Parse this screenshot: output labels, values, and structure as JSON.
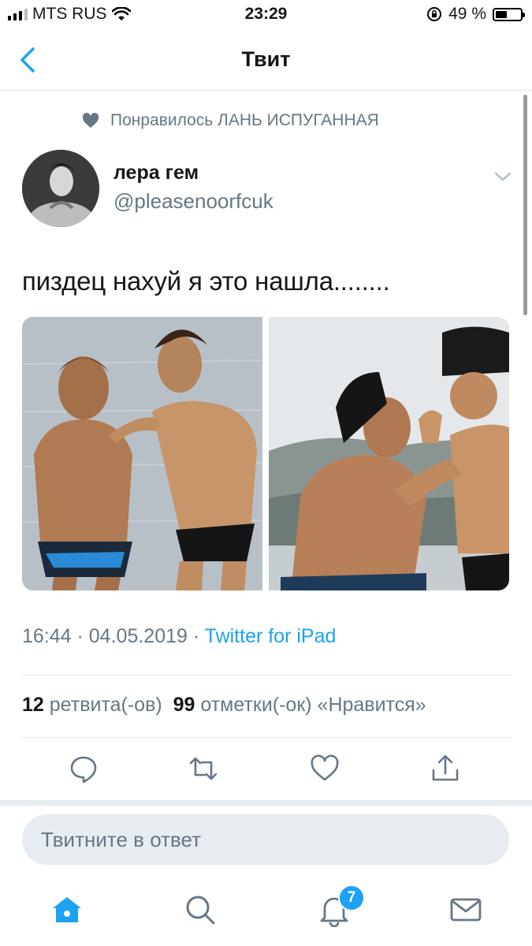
{
  "status": {
    "carrier": "MTS RUS",
    "time": "23:29",
    "battery_percent": "49 %",
    "battery_level": 0.49
  },
  "nav": {
    "title": "Твит"
  },
  "liked_by": {
    "text": "Понравилось ЛАНЬ ИСПУГАННАЯ"
  },
  "author": {
    "name": "лера гем",
    "handle": "@pleasenoorfcuk"
  },
  "tweet": {
    "text": "пиздец нахуй я это нашла........"
  },
  "meta": {
    "time": "16:44",
    "sep1": " · ",
    "date": "04.05.2019",
    "sep2": " · ",
    "source": "Twitter for iPad"
  },
  "stats": {
    "retweets": "12",
    "retweets_label": "ретвита(-ов)",
    "likes": "99",
    "likes_label": "отметки(-ок) «Нравится»"
  },
  "reply": {
    "placeholder": "Твитните в ответ"
  },
  "tabbar": {
    "notifications_badge": "7"
  },
  "colors": {
    "accent": "#1da1f2",
    "muted": "#657786",
    "divider": "#e1e8ed"
  }
}
